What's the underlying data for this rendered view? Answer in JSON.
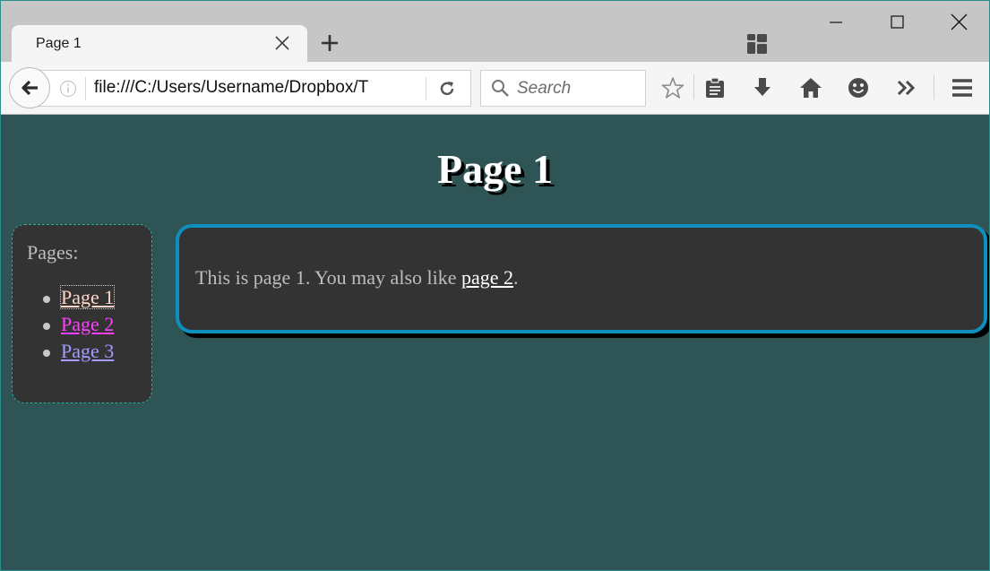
{
  "browser": {
    "tab": {
      "title": "Page 1"
    },
    "url": "file:///C:/Users/Username/Dropbox/T",
    "search": {
      "placeholder": "Search"
    }
  },
  "page": {
    "title": "Page 1",
    "sidebar": {
      "heading": "Pages:",
      "links": [
        {
          "label": "Page 1",
          "color": "#ffd6c6"
        },
        {
          "label": "Page 2",
          "color": "#ff3fff"
        },
        {
          "label": "Page 3",
          "color": "#a39bff"
        }
      ]
    },
    "main": {
      "text_before": "This is page 1. You may also like ",
      "link": "page 2",
      "text_after": "."
    }
  },
  "icons": {
    "tab_close": "close-icon",
    "new_tab": "plus-icon",
    "tab_groups": "tab-groups-icon",
    "back": "back-arrow-icon",
    "info": "info-icon",
    "reload": "reload-icon",
    "search": "search-icon",
    "bookmark": "star-icon",
    "reading_list": "clipboard-icon",
    "downloads": "download-icon",
    "home": "home-icon",
    "emoji": "smiley-icon",
    "overflow": "chevrons-right-icon",
    "menu": "hamburger-icon"
  },
  "colors": {
    "page_background": "#2f5455",
    "panel_background": "#333333",
    "main_border": "#0f8fbe",
    "sidebar_border": "#1fb6a0"
  }
}
